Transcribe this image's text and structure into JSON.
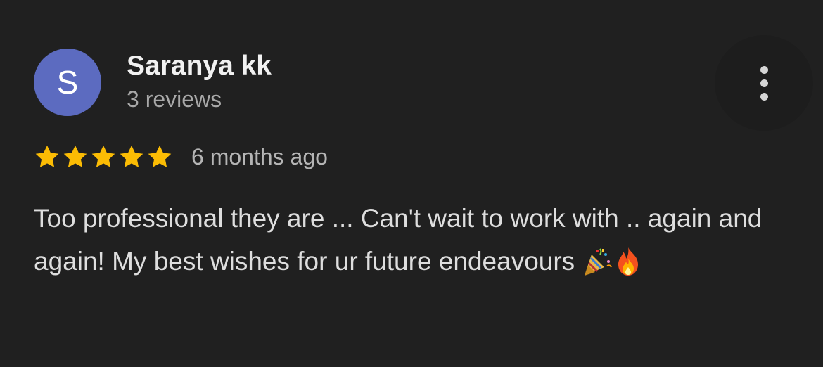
{
  "reviewer": {
    "initial": "S",
    "name": "Saranya kk",
    "reviews_count": "3 reviews",
    "avatar_color": "#5c6bc0"
  },
  "more_button": {
    "icon": "more-vertical-icon"
  },
  "rating": {
    "stars": 5,
    "max_stars": 5,
    "star_color": "#fbbc04",
    "date": "6 months ago"
  },
  "review": {
    "text": "Too professional they are ... Can't wait to work with .. again and again! My best wishes for ur future endeavours",
    "emojis": [
      "party-popper-icon",
      "fire-icon"
    ]
  }
}
